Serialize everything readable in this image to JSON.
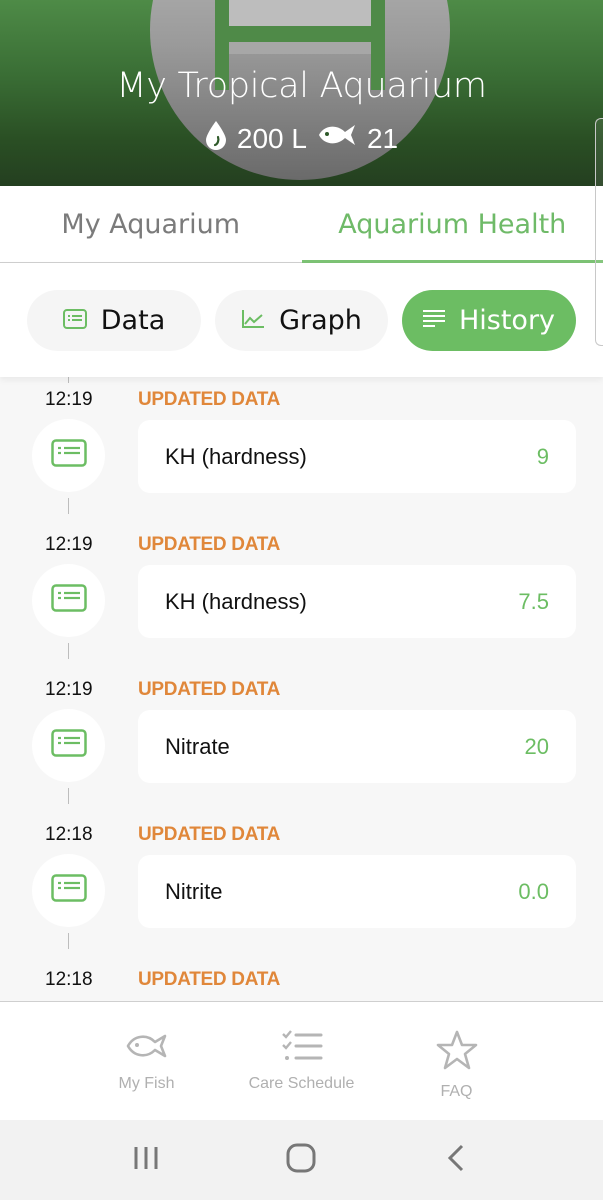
{
  "header": {
    "title": "My Tropical Aquarium",
    "volume": "200 L",
    "fish_count": "21",
    "volume_icon": "water-drop-icon",
    "fish_icon": "fish-icon"
  },
  "tabs": [
    {
      "label": "My Aquarium",
      "active": false
    },
    {
      "label": "Aquarium Health",
      "active": true
    }
  ],
  "segments": [
    {
      "label": "Data",
      "icon": "data-card-icon",
      "active": false
    },
    {
      "label": "Graph",
      "icon": "line-graph-icon",
      "active": false
    },
    {
      "label": "History",
      "icon": "lines-icon",
      "active": true
    }
  ],
  "history": [
    {
      "time": "12:19",
      "label": "UPDATED DATA",
      "parameter": "KH (hardness)",
      "value": "9"
    },
    {
      "time": "12:19",
      "label": "UPDATED DATA",
      "parameter": "KH (hardness)",
      "value": "7.5"
    },
    {
      "time": "12:19",
      "label": "UPDATED DATA",
      "parameter": "Nitrate",
      "value": "20"
    },
    {
      "time": "12:18",
      "label": "UPDATED DATA",
      "parameter": "Nitrite",
      "value": "0.0"
    },
    {
      "time": "12:18",
      "label": "UPDATED DATA",
      "parameter": "",
      "value": ""
    }
  ],
  "bottom_nav": [
    {
      "label": "My Fish",
      "icon": "fish-outline-icon"
    },
    {
      "label": "Care Schedule",
      "icon": "checklist-icon"
    },
    {
      "label": "FAQ",
      "icon": "star-icon"
    }
  ],
  "system_nav": {
    "recents": "recent-apps-icon",
    "home": "home-icon",
    "back": "back-icon"
  },
  "colors": {
    "accent_green": "#6cbd63",
    "label_orange": "#e0873a",
    "header_green": "#3a6e35"
  }
}
